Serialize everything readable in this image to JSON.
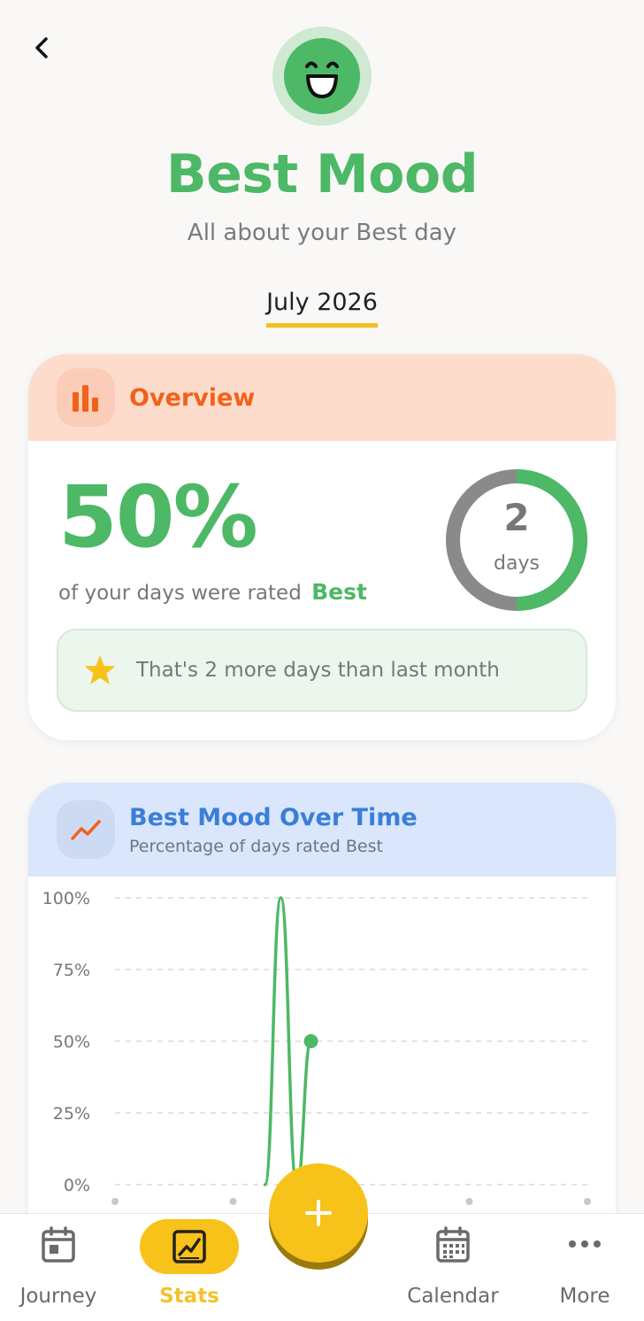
{
  "header": {
    "title": "Best Mood",
    "subtitle": "All about your Best day",
    "month": "July 2026"
  },
  "overview": {
    "title": "Overview",
    "percent": "50%",
    "rated_prefix": "of your days were rated",
    "rated_mood": "Best",
    "days_count": "2",
    "days_label": "days",
    "ring_fraction": 0.5,
    "compare_text": "That's 2 more days than last month"
  },
  "trend": {
    "title": "Best Mood Over Time",
    "subtitle": "Percentage of days rated Best"
  },
  "chart_data": {
    "type": "line",
    "y_ticks": [
      "100%",
      "75%",
      "50%",
      "25%",
      "0%"
    ],
    "ylim": [
      0,
      100
    ],
    "x_points": 5,
    "series": [
      {
        "values": [
          0,
          100,
          0,
          50
        ]
      }
    ],
    "grid": true
  },
  "nav": {
    "items": [
      {
        "label": "Journey"
      },
      {
        "label": "Stats"
      },
      {
        "label": "Calendar"
      },
      {
        "label": "More"
      }
    ],
    "active": "Stats"
  },
  "colors": {
    "best_green": "#4db866",
    "overview_orange": "#f0621b",
    "trend_blue": "#3b7ed8",
    "accent_yellow": "#f7c21a"
  },
  "icons": {
    "back": "chevron-left-icon",
    "mood": "grinning-face-icon",
    "overview": "bar-chart-icon",
    "star": "star-icon",
    "trend": "trend-line-icon",
    "add": "plus-icon"
  }
}
